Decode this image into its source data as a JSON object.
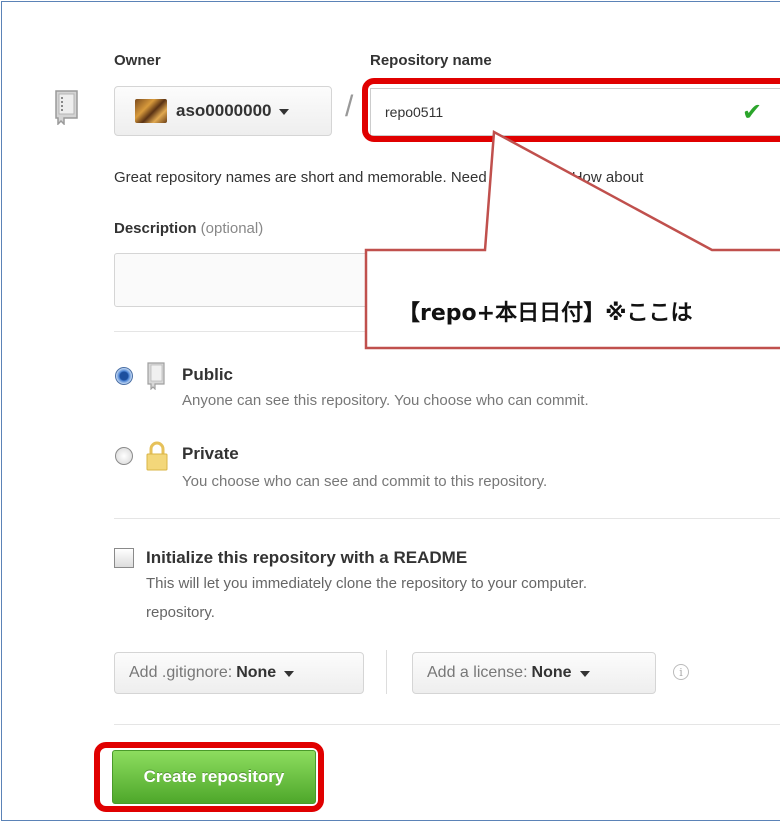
{
  "form": {
    "owner_label": "Owner",
    "repo_name_label": "Repository name",
    "owner_value": "aso0000000",
    "slash": "/",
    "repo_name_value": "repo0511",
    "name_hint": "Great repository names are short and memorable. Need inspiration? How about",
    "description_label": "Description",
    "description_optional": " (optional)",
    "description_value": ""
  },
  "visibility": {
    "public_title": "Public",
    "public_desc": "Anyone can see this repository. You choose who can commit.",
    "private_title": "Private",
    "private_desc": "You choose who can see and commit to this repository.",
    "selected": "public"
  },
  "readme": {
    "title": "Initialize this repository with a README",
    "desc_line1": "This will let you immediately clone the repository to your computer.",
    "desc_line2": "repository.",
    "checked": false
  },
  "options": {
    "gitignore_prefix": "Add .gitignore:",
    "gitignore_value": "None",
    "license_prefix": "Add a license:",
    "license_value": "None"
  },
  "actions": {
    "create_label": "Create repository"
  },
  "annotation": {
    "callout_text": "【repo+本日日付】※ここは"
  },
  "colors": {
    "highlight": "#e00000",
    "create_green": "#5cb738",
    "check_green": "#2ba52b"
  }
}
